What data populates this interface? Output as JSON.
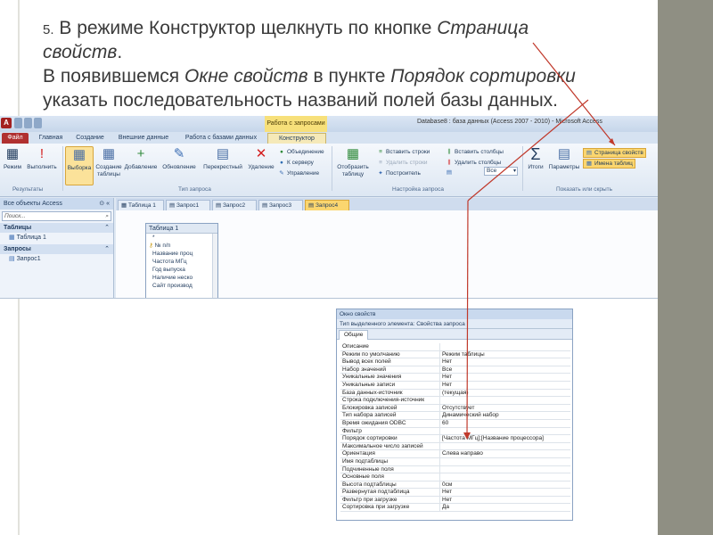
{
  "slide": {
    "line1_num": "5.",
    "line1_text": " В режиме Конструктор щелкнуть по кнопке ",
    "line1_italic": "Страница",
    "line2_italic": "свойств",
    "line2_text": ".",
    "line3_text": "В появившемся ",
    "line3_italic1": "Окне свойств",
    "line3_mid": " в пункте ",
    "line3_italic2": "Порядок сортировки",
    "line4_text": "указать последовательность названий полей базы данных."
  },
  "access": {
    "window_title": "Database8 : база данных (Access 2007 - 2010) - Microsoft Access",
    "context_tab": "Работа с запросами",
    "logo": "A",
    "tabs": [
      "Файл",
      "Главная",
      "Создание",
      "Внешние данные",
      "Работа с базами данных",
      "Конструктор"
    ],
    "ribbon": {
      "results": {
        "mode": "Режим",
        "run": "Выполнить",
        "group": "Результаты"
      },
      "query_type": {
        "select": "Выборка",
        "make_table": "Создание таблицы",
        "append": "Добавление",
        "update": "Обновление",
        "crosstab": "Перекрестный",
        "delete": "Удаление",
        "union": "Объединение",
        "server": "К серверу",
        "manage": "Управление",
        "group": "Тип запроса"
      },
      "setup": {
        "show_table": "Отобразить таблицу",
        "insert_rows": "Вставить строки",
        "delete_rows": "Удалить строки",
        "builder": "Построитель",
        "insert_cols": "Вставить столбцы",
        "delete_cols": "Удалить столбцы",
        "return_label": "Все",
        "group": "Настройка запроса"
      },
      "show_hide": {
        "totals": "Итоги",
        "params": "Параметры",
        "property_sheet": "Страница свойств",
        "table_names": "Имена таблиц",
        "group": "Показать или скрыть"
      }
    },
    "nav": {
      "header": "Все объекты Access",
      "search_placeholder": "Поиск...",
      "group_tables": "Таблицы",
      "table1": "Таблица 1",
      "group_queries": "Запросы",
      "query1": "Запрос1"
    },
    "doc_tabs": [
      "Таблица 1",
      "Запрос1",
      "Запрос2",
      "Запрос3",
      "Запрос4"
    ],
    "table_box": {
      "title": "Таблица 1",
      "fields": [
        "*",
        "№ п/п",
        "Название проц",
        "Частота МГц",
        "Год выпуска",
        "Наличие неско",
        "Сайт производ"
      ]
    }
  },
  "props": {
    "title": "Окно свойств",
    "type_line": "Тип выделенного элемента: Свойства запроса",
    "tab": "Общие",
    "rows": [
      {
        "k": "Описание",
        "v": ""
      },
      {
        "k": "Режим по умолчанию",
        "v": "Режим таблицы"
      },
      {
        "k": "Вывод всех полей",
        "v": "Нет"
      },
      {
        "k": "Набор значений",
        "v": "Все"
      },
      {
        "k": "Уникальные значения",
        "v": "Нет"
      },
      {
        "k": "Уникальные записи",
        "v": "Нет"
      },
      {
        "k": "База данных-источник",
        "v": "(текущая)"
      },
      {
        "k": "Строка подключения-источник",
        "v": ""
      },
      {
        "k": "Блокировка записей",
        "v": "Отсутствует"
      },
      {
        "k": "Тип набора записей",
        "v": "Динамический набор"
      },
      {
        "k": "Время ожидания ODBC",
        "v": "60"
      },
      {
        "k": "Фильтр",
        "v": ""
      },
      {
        "k": "Порядок сортировки",
        "v": "[Частота МГц];[Название процессора]"
      },
      {
        "k": "Максимальное число записей",
        "v": ""
      },
      {
        "k": "Ориентация",
        "v": "Слева направо"
      },
      {
        "k": "Имя подтаблицы",
        "v": ""
      },
      {
        "k": "Подчиненные поля",
        "v": ""
      },
      {
        "k": "Основные поля",
        "v": ""
      },
      {
        "k": "Высота подтаблицы",
        "v": "0см"
      },
      {
        "k": "Развернутая подтаблица",
        "v": "Нет"
      },
      {
        "k": "Фильтр при загрузке",
        "v": "Нет"
      },
      {
        "k": "Сортировка при загрузке",
        "v": "Да"
      }
    ]
  }
}
